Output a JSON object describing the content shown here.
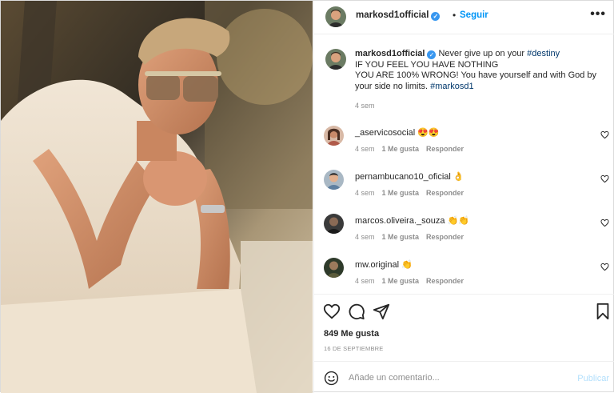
{
  "post": {
    "username": "markosd1official",
    "verified_icon": "verified-badge-icon",
    "separator": "•",
    "follow_label": "Seguir",
    "more_icon": "more-options-icon"
  },
  "caption": {
    "username": "markosd1official",
    "text_before_tag": "Never give up on your",
    "tag1": "#destiny",
    "line2": "IF YOU FEEL YOU HAVE NOTHING",
    "line3": "YOU ARE 100% WRONG! You have yourself and with God by your side no limits.",
    "tag2": "#markosd1",
    "time": "4 sem"
  },
  "comments": [
    {
      "username": "_aservicosocial",
      "emoji": "😍😍",
      "time": "4 sem",
      "likes": "1 Me gusta",
      "reply": "Responder"
    },
    {
      "username": "pernambucano10_oficial",
      "emoji": "👌",
      "time": "4 sem",
      "likes": "1 Me gusta",
      "reply": "Responder"
    },
    {
      "username": "marcos.oliveira._souza",
      "emoji": "👏👏",
      "time": "4 sem",
      "likes": "1 Me gusta",
      "reply": "Responder"
    },
    {
      "username": "mw.original",
      "emoji": "👏",
      "time": "4 sem",
      "likes": "1 Me gusta",
      "reply": "Responder"
    }
  ],
  "actions": {
    "like_icon": "heart-icon",
    "comment_icon": "comment-icon",
    "share_icon": "share-icon",
    "save_icon": "bookmark-icon",
    "likes_text": "849 Me gusta",
    "date": "16 DE SEPTIEMBRE"
  },
  "add_comment": {
    "placeholder": "Añade un comentario...",
    "publish_label": "Publicar",
    "emoji_icon": "emoji-icon"
  },
  "colors": {
    "accent": "#0095f6",
    "publish_disabled": "#b2dffc",
    "muted": "#8e8e8e",
    "text": "#262626"
  }
}
